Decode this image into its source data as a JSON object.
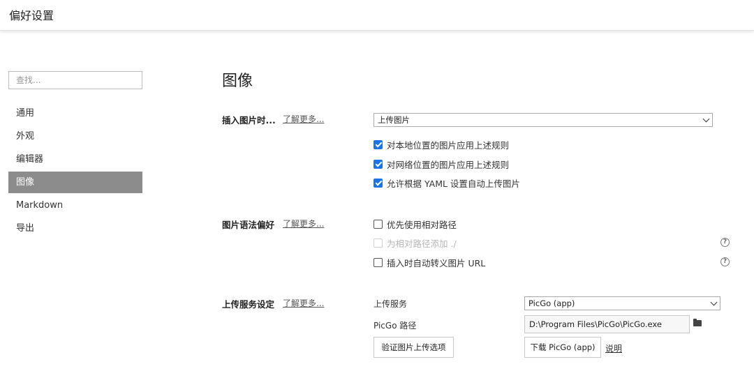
{
  "window": {
    "title": "偏好设置"
  },
  "sidebar": {
    "search_placeholder": "查找...",
    "items": [
      {
        "label": "通用"
      },
      {
        "label": "外观"
      },
      {
        "label": "编辑器"
      },
      {
        "label": "图像",
        "active": true
      },
      {
        "label": "Markdown"
      },
      {
        "label": "导出"
      }
    ]
  },
  "main": {
    "title": "图像",
    "insert": {
      "label": "插入图片时...",
      "learn_more": "了解更多...",
      "action_value": "上传图片",
      "options": [
        {
          "label": "对本地位置的图片应用上述规则",
          "checked": true
        },
        {
          "label": "对网络位置的图片应用上述规则",
          "checked": true
        },
        {
          "label": "允许根据 YAML 设置自动上传图片",
          "checked": true
        }
      ]
    },
    "syntax": {
      "label": "图片语法偏好",
      "learn_more": "了解更多...",
      "options": [
        {
          "label": "优先使用相对路径",
          "checked": false
        },
        {
          "label": "为相对路径添加 ./",
          "checked": false,
          "disabled": true
        },
        {
          "label": "插入时自动转义图片 URL",
          "checked": false
        }
      ]
    },
    "upload": {
      "label": "上传服务设定",
      "learn_more": "了解更多...",
      "service_label": "上传服务",
      "service_value": "PicGo (app)",
      "path_label": "PicGo 路径",
      "path_value": "D:\\Program Files\\PicGo\\PicGo.exe",
      "verify_button": "验证图片上传选项",
      "download_button": "下载 PicGo (app)",
      "explain_link": "说明"
    }
  },
  "colors": {
    "accent": "#1a73e8",
    "active_nav": "#8c8c8c"
  }
}
